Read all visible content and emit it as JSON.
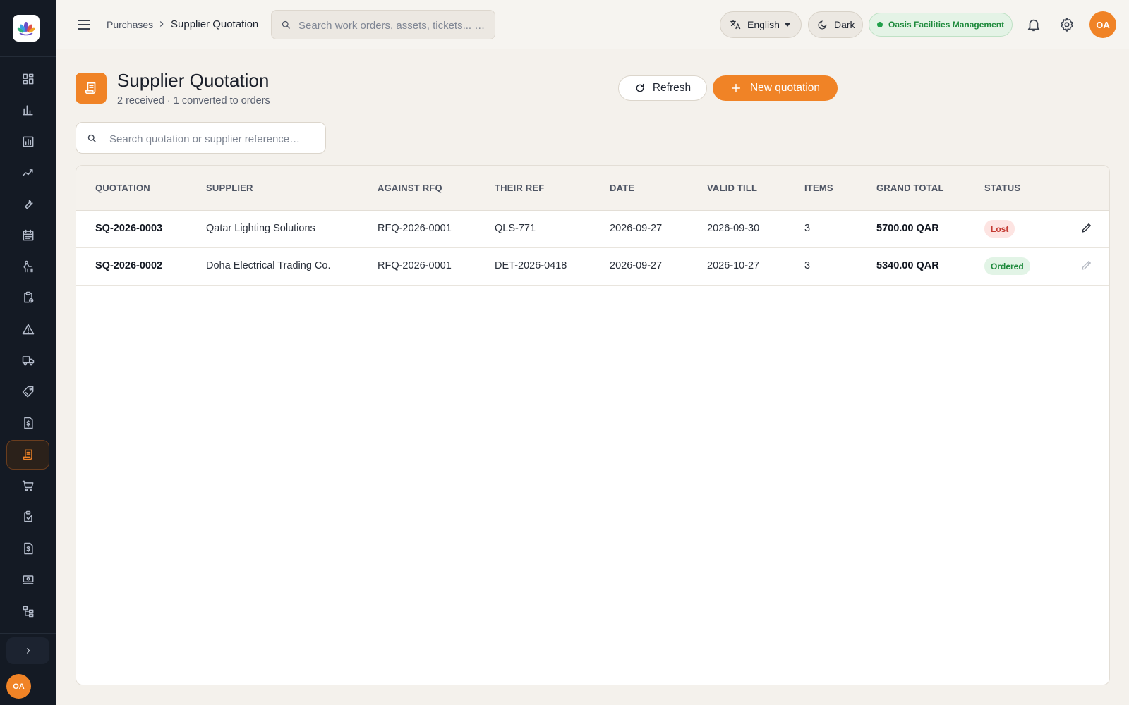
{
  "topbar": {
    "breadcrumb_parent": "Purchases",
    "breadcrumb_current": "Supplier Quotation",
    "search_placeholder": "Search work orders, assets, tickets... …",
    "language": "English",
    "theme_toggle": "Dark",
    "organization": "Oasis Facilities Management",
    "user_initials": "OA"
  },
  "sidebar": {
    "items": [
      "dashboard-icon",
      "bar-chart-icon",
      "report-icon",
      "trend-icon",
      "wrench-icon",
      "calendar-icon",
      "technician-icon",
      "clipboard-icon",
      "warning-icon",
      "truck-icon",
      "tag-icon",
      "invoice-icon",
      "quotation-icon",
      "cart-icon",
      "checklist-icon",
      "billing-icon",
      "payment-icon",
      "hierarchy-icon"
    ],
    "active_item": "quotation-icon",
    "user_initials": "OA"
  },
  "page": {
    "title": "Supplier Quotation",
    "subtitle": "2 received · 1 converted to orders",
    "refresh_label": "Refresh",
    "new_label": "New quotation",
    "search_placeholder": "Search quotation or supplier reference…"
  },
  "table": {
    "headers": [
      "QUOTATION",
      "SUPPLIER",
      "AGAINST RFQ",
      "THEIR REF",
      "DATE",
      "VALID TILL",
      "ITEMS",
      "GRAND TOTAL",
      "STATUS"
    ],
    "rows": [
      {
        "quotation": "SQ-2026-0003",
        "supplier": "Qatar Lighting Solutions",
        "rfq": "RFQ-2026-0001",
        "their_ref": "QLS-771",
        "date": "2026-09-27",
        "valid_till": "2026-09-30",
        "items": "3",
        "grand_total": "5700.00 QAR",
        "status": "Lost",
        "status_type": "lost"
      },
      {
        "quotation": "SQ-2026-0002",
        "supplier": "Doha Electrical Trading Co.",
        "rfq": "RFQ-2026-0001",
        "their_ref": "DET-2026-0418",
        "date": "2026-09-27",
        "valid_till": "2026-10-27",
        "items": "3",
        "grand_total": "5340.00 QAR",
        "status": "Ordered",
        "status_type": "ordered"
      }
    ]
  },
  "colors": {
    "accent": "#f08326",
    "sidebar_bg": "#141a24",
    "page_bg": "#f4f1ec",
    "lost": "#c43a32",
    "ordered": "#1e8a3c"
  }
}
